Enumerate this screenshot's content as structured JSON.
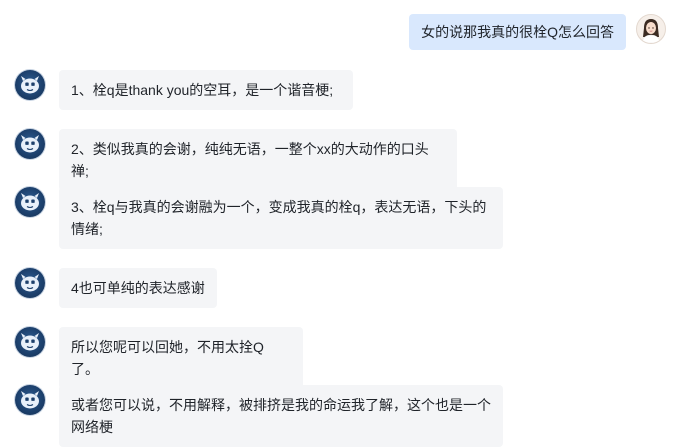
{
  "user_message": {
    "text": "女的说那我真的很栓Q怎么回答",
    "avatar_icon": "user-avatar-icon"
  },
  "bot_avatar_icon": "bot-avatar-icon",
  "bot_messages": [
    {
      "text": "1、栓q是thank you的空耳，是一个谐音梗;"
    },
    {
      "text": "2、类似我真的会谢，纯纯无语，一整个xx的大动作的口头禅;"
    },
    {
      "text": "3、栓q与我真的会谢融为一个，变成我真的栓q，表达无语，下头的情绪;"
    },
    {
      "text": "4也可单纯的表达感谢"
    },
    {
      "text": "所以您呢可以回她，不用太拴Q了。"
    },
    {
      "text": "或者您可以说，不用解释，被排挤是我的命运我了解，这个也是一个网络梗"
    }
  ],
  "colors": {
    "user_bubble": "#d9e8fd",
    "bot_bubble": "#f4f5f7",
    "bot_avatar": "#1c3f6b"
  }
}
